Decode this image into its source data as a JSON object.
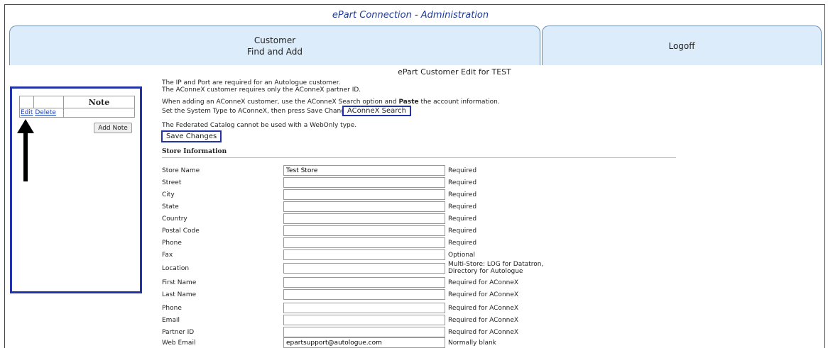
{
  "header": {
    "title": "ePart Connection - Administration"
  },
  "nav": {
    "customer_line1": "Customer",
    "customer_line2": "Find and Add",
    "logoff": "Logoff"
  },
  "page": {
    "heading": "ePart Customer Edit for TEST"
  },
  "notes": {
    "column_header": "Note",
    "edit_link": "Edit",
    "delete_link": "Delete",
    "add_note_label": "Add Note"
  },
  "instructions": {
    "line1": "The IP and Port are required for an Autologue customer.",
    "line2": "The AConneX customer requires only the AConneX partner ID.",
    "line3_pre": "When adding an AConneX customer, use the AConneX Search option and ",
    "line3_bold": "Paste",
    "line3_post": " the account information.",
    "line4": "Set the System Type to AConneX, then press Save Changes.",
    "aconnex_search_label": "AConneX Search",
    "line5": "The Federated Catalog cannot be used with a WebOnly type.",
    "save_changes_label": "Save Changes"
  },
  "store_section": {
    "title": "Store Information",
    "fields": [
      {
        "label": "Store Name",
        "value": "Test Store",
        "hint": "Required"
      },
      {
        "label": "Street",
        "value": "",
        "hint": "Required"
      },
      {
        "label": "City",
        "value": "",
        "hint": "Required"
      },
      {
        "label": "State",
        "value": "",
        "hint": "Required"
      },
      {
        "label": "Country",
        "value": "",
        "hint": "Required"
      },
      {
        "label": "Postal Code",
        "value": "",
        "hint": "Required"
      },
      {
        "label": "Phone",
        "value": "",
        "hint": "Required"
      },
      {
        "label": "Fax",
        "value": "",
        "hint": "Optional"
      },
      {
        "label": "Location",
        "value": "",
        "hint_line1": "Multi-Store: LOG for Datatron,",
        "hint_line2": "Directory for Autologue"
      },
      {
        "label": "First Name",
        "value": "",
        "hint": "Required for AConneX"
      },
      {
        "label": "Last Name",
        "value": "",
        "hint": "Required for AConneX"
      },
      {
        "label": "Phone",
        "value": "",
        "hint": "Required for AConneX"
      },
      {
        "label": "Email",
        "value": "",
        "hint": "Required for AConneX"
      },
      {
        "label": "Partner ID",
        "value": "",
        "hint": "Required for AConneX"
      },
      {
        "label": "Web Email",
        "value": "epartsupport@autologue.com",
        "hint": "Normally blank"
      }
    ]
  },
  "colors": {
    "accent_border": "#2233aa",
    "tab_fill": "#dcecfa",
    "title_text": "#1f3d99",
    "link": "#1a3fb3"
  }
}
